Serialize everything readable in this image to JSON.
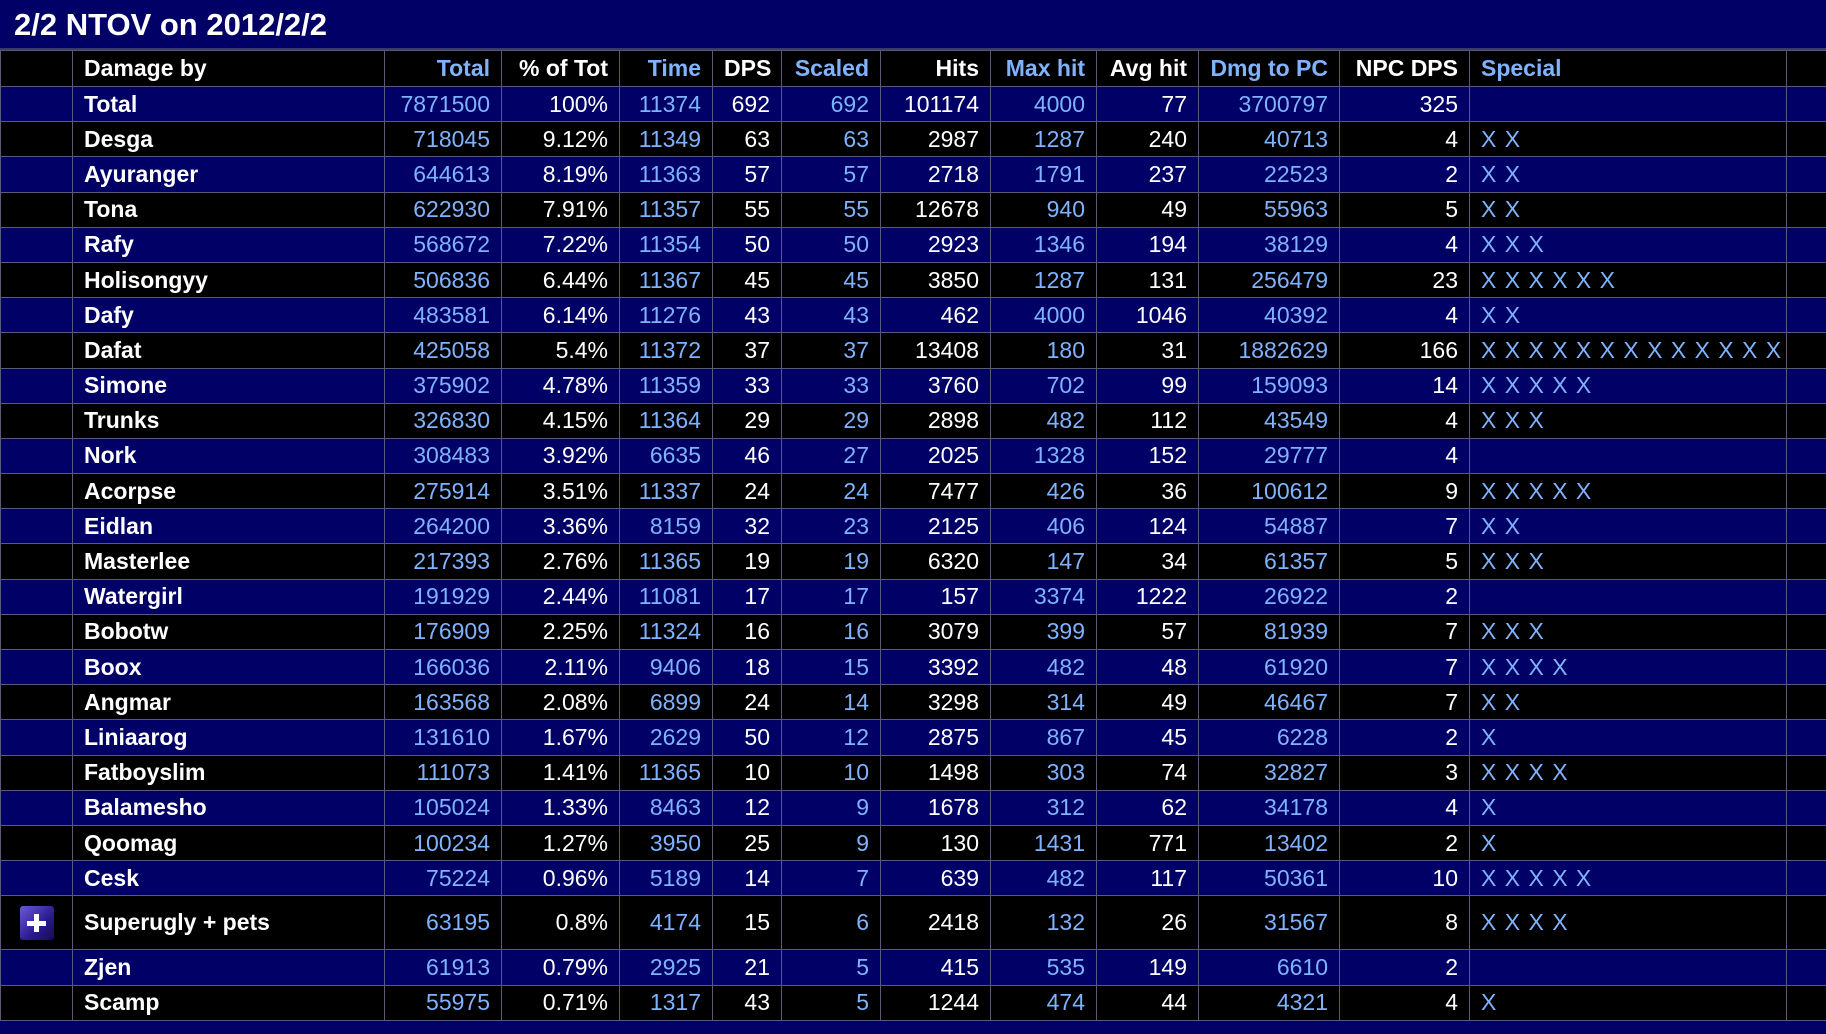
{
  "title": "2/2 NTOV on 2012/2/2",
  "headers": [
    "Damage by",
    "Total",
    "% of Tot",
    "Time",
    "DPS",
    "Scaled",
    "Hits",
    "Max hit",
    "Avg hit",
    "Dmg to PC",
    "NPC DPS",
    "Special"
  ],
  "rows": [
    {
      "name": "Total",
      "total": "7871500",
      "pct": "100%",
      "time": "11374",
      "dps": "692",
      "scaled": "692",
      "hits": "101174",
      "max_hit": "4000",
      "avg_hit": "77",
      "dmg_to_pc": "3700797",
      "npc_dps": "325",
      "special": ""
    },
    {
      "name": "Desga",
      "total": "718045",
      "pct": "9.12%",
      "time": "11349",
      "dps": "63",
      "scaled": "63",
      "hits": "2987",
      "max_hit": "1287",
      "avg_hit": "240",
      "dmg_to_pc": "40713",
      "npc_dps": "4",
      "special": "X X"
    },
    {
      "name": "Ayuranger",
      "total": "644613",
      "pct": "8.19%",
      "time": "11363",
      "dps": "57",
      "scaled": "57",
      "hits": "2718",
      "max_hit": "1791",
      "avg_hit": "237",
      "dmg_to_pc": "22523",
      "npc_dps": "2",
      "special": "X X"
    },
    {
      "name": "Tona",
      "total": "622930",
      "pct": "7.91%",
      "time": "11357",
      "dps": "55",
      "scaled": "55",
      "hits": "12678",
      "max_hit": "940",
      "avg_hit": "49",
      "dmg_to_pc": "55963",
      "npc_dps": "5",
      "special": "X X"
    },
    {
      "name": "Rafy",
      "total": "568672",
      "pct": "7.22%",
      "time": "11354",
      "dps": "50",
      "scaled": "50",
      "hits": "2923",
      "max_hit": "1346",
      "avg_hit": "194",
      "dmg_to_pc": "38129",
      "npc_dps": "4",
      "special": "X X X"
    },
    {
      "name": "Holisongyy",
      "total": "506836",
      "pct": "6.44%",
      "time": "11367",
      "dps": "45",
      "scaled": "45",
      "hits": "3850",
      "max_hit": "1287",
      "avg_hit": "131",
      "dmg_to_pc": "256479",
      "npc_dps": "23",
      "special": "X X X X X X"
    },
    {
      "name": "Dafy",
      "total": "483581",
      "pct": "6.14%",
      "time": "11276",
      "dps": "43",
      "scaled": "43",
      "hits": "462",
      "max_hit": "4000",
      "avg_hit": "1046",
      "dmg_to_pc": "40392",
      "npc_dps": "4",
      "special": "X X"
    },
    {
      "name": "Dafat",
      "total": "425058",
      "pct": "5.4%",
      "time": "11372",
      "dps": "37",
      "scaled": "37",
      "hits": "13408",
      "max_hit": "180",
      "avg_hit": "31",
      "dmg_to_pc": "1882629",
      "npc_dps": "166",
      "special": "X X X X X X X X X X X X X X"
    },
    {
      "name": "Simone",
      "total": "375902",
      "pct": "4.78%",
      "time": "11359",
      "dps": "33",
      "scaled": "33",
      "hits": "3760",
      "max_hit": "702",
      "avg_hit": "99",
      "dmg_to_pc": "159093",
      "npc_dps": "14",
      "special": "X X X X X"
    },
    {
      "name": "Trunks",
      "total": "326830",
      "pct": "4.15%",
      "time": "11364",
      "dps": "29",
      "scaled": "29",
      "hits": "2898",
      "max_hit": "482",
      "avg_hit": "112",
      "dmg_to_pc": "43549",
      "npc_dps": "4",
      "special": "X X X"
    },
    {
      "name": "Nork",
      "total": "308483",
      "pct": "3.92%",
      "time": "6635",
      "dps": "46",
      "scaled": "27",
      "hits": "2025",
      "max_hit": "1328",
      "avg_hit": "152",
      "dmg_to_pc": "29777",
      "npc_dps": "4",
      "special": ""
    },
    {
      "name": "Acorpse",
      "total": "275914",
      "pct": "3.51%",
      "time": "11337",
      "dps": "24",
      "scaled": "24",
      "hits": "7477",
      "max_hit": "426",
      "avg_hit": "36",
      "dmg_to_pc": "100612",
      "npc_dps": "9",
      "special": "X X X X X"
    },
    {
      "name": "Eidlan",
      "total": "264200",
      "pct": "3.36%",
      "time": "8159",
      "dps": "32",
      "scaled": "23",
      "hits": "2125",
      "max_hit": "406",
      "avg_hit": "124",
      "dmg_to_pc": "54887",
      "npc_dps": "7",
      "special": "X X"
    },
    {
      "name": "Masterlee",
      "total": "217393",
      "pct": "2.76%",
      "time": "11365",
      "dps": "19",
      "scaled": "19",
      "hits": "6320",
      "max_hit": "147",
      "avg_hit": "34",
      "dmg_to_pc": "61357",
      "npc_dps": "5",
      "special": "X X X"
    },
    {
      "name": "Watergirl",
      "total": "191929",
      "pct": "2.44%",
      "time": "11081",
      "dps": "17",
      "scaled": "17",
      "hits": "157",
      "max_hit": "3374",
      "avg_hit": "1222",
      "dmg_to_pc": "26922",
      "npc_dps": "2",
      "special": ""
    },
    {
      "name": "Bobotw",
      "total": "176909",
      "pct": "2.25%",
      "time": "11324",
      "dps": "16",
      "scaled": "16",
      "hits": "3079",
      "max_hit": "399",
      "avg_hit": "57",
      "dmg_to_pc": "81939",
      "npc_dps": "7",
      "special": "X X X"
    },
    {
      "name": "Boox",
      "total": "166036",
      "pct": "2.11%",
      "time": "9406",
      "dps": "18",
      "scaled": "15",
      "hits": "3392",
      "max_hit": "482",
      "avg_hit": "48",
      "dmg_to_pc": "61920",
      "npc_dps": "7",
      "special": "X X X X"
    },
    {
      "name": "Angmar",
      "total": "163568",
      "pct": "2.08%",
      "time": "6899",
      "dps": "24",
      "scaled": "14",
      "hits": "3298",
      "max_hit": "314",
      "avg_hit": "49",
      "dmg_to_pc": "46467",
      "npc_dps": "7",
      "special": "X X"
    },
    {
      "name": "Liniaarog",
      "total": "131610",
      "pct": "1.67%",
      "time": "2629",
      "dps": "50",
      "scaled": "12",
      "hits": "2875",
      "max_hit": "867",
      "avg_hit": "45",
      "dmg_to_pc": "6228",
      "npc_dps": "2",
      "special": "X"
    },
    {
      "name": "Fatboyslim",
      "total": "111073",
      "pct": "1.41%",
      "time": "11365",
      "dps": "10",
      "scaled": "10",
      "hits": "1498",
      "max_hit": "303",
      "avg_hit": "74",
      "dmg_to_pc": "32827",
      "npc_dps": "3",
      "special": "X X X X"
    },
    {
      "name": "Balamesho",
      "total": "105024",
      "pct": "1.33%",
      "time": "8463",
      "dps": "12",
      "scaled": "9",
      "hits": "1678",
      "max_hit": "312",
      "avg_hit": "62",
      "dmg_to_pc": "34178",
      "npc_dps": "4",
      "special": "X"
    },
    {
      "name": "Qoomag",
      "total": "100234",
      "pct": "1.27%",
      "time": "3950",
      "dps": "25",
      "scaled": "9",
      "hits": "130",
      "max_hit": "1431",
      "avg_hit": "771",
      "dmg_to_pc": "13402",
      "npc_dps": "2",
      "special": "X"
    },
    {
      "name": "Cesk",
      "total": "75224",
      "pct": "0.96%",
      "time": "5189",
      "dps": "14",
      "scaled": "7",
      "hits": "639",
      "max_hit": "482",
      "avg_hit": "117",
      "dmg_to_pc": "50361",
      "npc_dps": "10",
      "special": "X X X X X"
    },
    {
      "name": "Superugly + pets",
      "total": "63195",
      "pct": "0.8%",
      "time": "4174",
      "dps": "15",
      "scaled": "6",
      "hits": "2418",
      "max_hit": "132",
      "avg_hit": "26",
      "dmg_to_pc": "31567",
      "npc_dps": "8",
      "special": "X X X X",
      "expandable": true
    },
    {
      "name": "Zjen",
      "total": "61913",
      "pct": "0.79%",
      "time": "2925",
      "dps": "21",
      "scaled": "5",
      "hits": "415",
      "max_hit": "535",
      "avg_hit": "149",
      "dmg_to_pc": "6610",
      "npc_dps": "2",
      "special": ""
    },
    {
      "name": "Scamp",
      "total": "55975",
      "pct": "0.71%",
      "time": "1317",
      "dps": "43",
      "scaled": "5",
      "hits": "1244",
      "max_hit": "474",
      "avg_hit": "44",
      "dmg_to_pc": "4321",
      "npc_dps": "4",
      "special": "X"
    }
  ],
  "icons": {
    "expand": "plus-expand-icon"
  },
  "colors": {
    "background": "#000066",
    "alt_row": "#000000",
    "text": "#ffffff",
    "link": "#7fb2ff"
  }
}
